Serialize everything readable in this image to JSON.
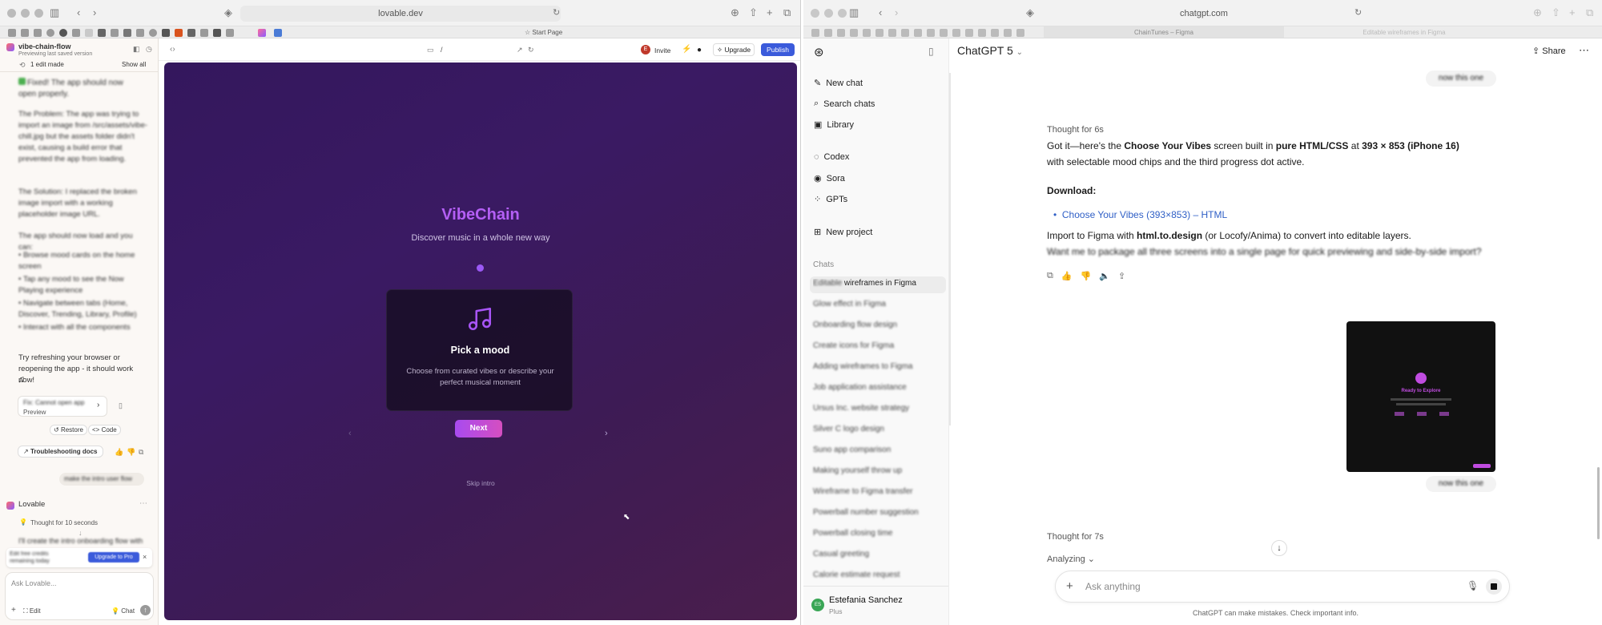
{
  "colors": {
    "accent": "#a855f7",
    "publish": "#3b5bdb",
    "link": "#2f5fc6",
    "stage_top": "#34175d",
    "stage_bottom": "#4a1e4c"
  },
  "left_browser": {
    "url": "lovable.dev",
    "tab_start": "Start Page",
    "project": {
      "name": "vibe-chain-flow",
      "sub": "Previewing last saved version",
      "edits": "1 edit made",
      "show_all": "Show all"
    },
    "chat": {
      "fixed": "Fixed! The app should now open properly.",
      "problem": "The Problem: The app was trying to import an image from /src/assets/vibe-chill.jpg but the assets folder didn't exist, causing a build error that prevented the app from loading.",
      "solution": "The Solution: I replaced the broken image import with a working placeholder image URL.",
      "should": "The app should now load and you can:",
      "bullets": [
        "Browse mood cards on the home screen",
        "Tap any mood to see the Now Playing experience",
        "Navigate between tabs (Home, Discover, Trending, Library, Profile)",
        "Interact with all the components"
      ],
      "try": "Try refreshing your browser or reopening the app - it should work now!",
      "note_icon": "music-note",
      "card_title": "Fix: Cannot open app",
      "card_sub": "Preview",
      "restore": "Restore",
      "code": "Code",
      "docs": "Troubleshooting docs",
      "user_msg": "make the intro user flow",
      "agent": "Lovable",
      "thought": "Thought for 10 seconds",
      "reply": "I'll create the intro onboarding flow with",
      "credits": "Edit free credits remaining today",
      "upgrade": "Upgrade to Pro",
      "input_placeholder": "Ask Lovable...",
      "edit": "Edit",
      "chat": "Chat"
    },
    "toolbar": {
      "path": "/",
      "invite": "Invite",
      "upgrade": "Upgrade",
      "publish": "Publish",
      "avatar": "E"
    },
    "preview": {
      "title": "VibeChain",
      "subtitle": "Discover music in a whole new way",
      "card_title": "Pick a mood",
      "card_desc": "Choose from curated vibes or describe your perfect musical moment",
      "next": "Next",
      "skip": "Skip intro",
      "prev_arrow": "‹",
      "next_arrow": "›"
    }
  },
  "right_browser": {
    "url": "chatgpt.com",
    "tabs": [
      "ChainTunes – Figma",
      "Editable wireframes in Figma"
    ],
    "model": "ChatGPT 5",
    "share": "Share",
    "nav": [
      "New chat",
      "Search chats",
      "Library",
      "Codex",
      "Sora",
      "GPTs",
      "New project"
    ],
    "chats_header": "Chats",
    "chats": [
      "Editable wireframes in Figma",
      "Glow effect in Figma",
      "Onboarding flow design",
      "Create icons for Figma",
      "Adding wireframes to Figma",
      "Job application assistance",
      "Ursus Inc. website strategy",
      "Silver C logo design",
      "Suno app comparison",
      "Making yourself throw up",
      "Wireframe to Figma transfer",
      "Powerball number suggestion",
      "Powerball closing time",
      "Casual greeting",
      "Calorie estimate request"
    ],
    "user": {
      "name": "Estefania Sanchez",
      "plan": "Plus",
      "initials": "ES"
    },
    "messages": {
      "user_bubble_1": "now this one",
      "thought1": "Thought for 6s",
      "p1_a": "Got it—here's the ",
      "p1_b": "Choose Your Vibes",
      "p1_c": " screen built in ",
      "p1_d": "pure HTML/CSS",
      "p1_e": " at ",
      "p1_f": "393 × 853 (iPhone 16)",
      "p1_g": " with selectable mood chips and the third progress dot active.",
      "download": "Download:",
      "link": "Choose Your Vibes (393×853) – HTML",
      "p2_a": "Import to Figma with ",
      "p2_b": "html.to.design",
      "p2_c": " (or Locofy/Anima) to convert into editable layers.",
      "p3": "Want me to package all three screens into a single page for quick previewing and side-by-side import?",
      "image_title": "Ready to Explore",
      "user_bubble_2": "now this one",
      "thought2": "Thought for 7s",
      "analyzing": "Analyzing"
    },
    "input_placeholder": "Ask anything",
    "disclaimer": "ChatGPT can make mistakes. Check important info."
  }
}
